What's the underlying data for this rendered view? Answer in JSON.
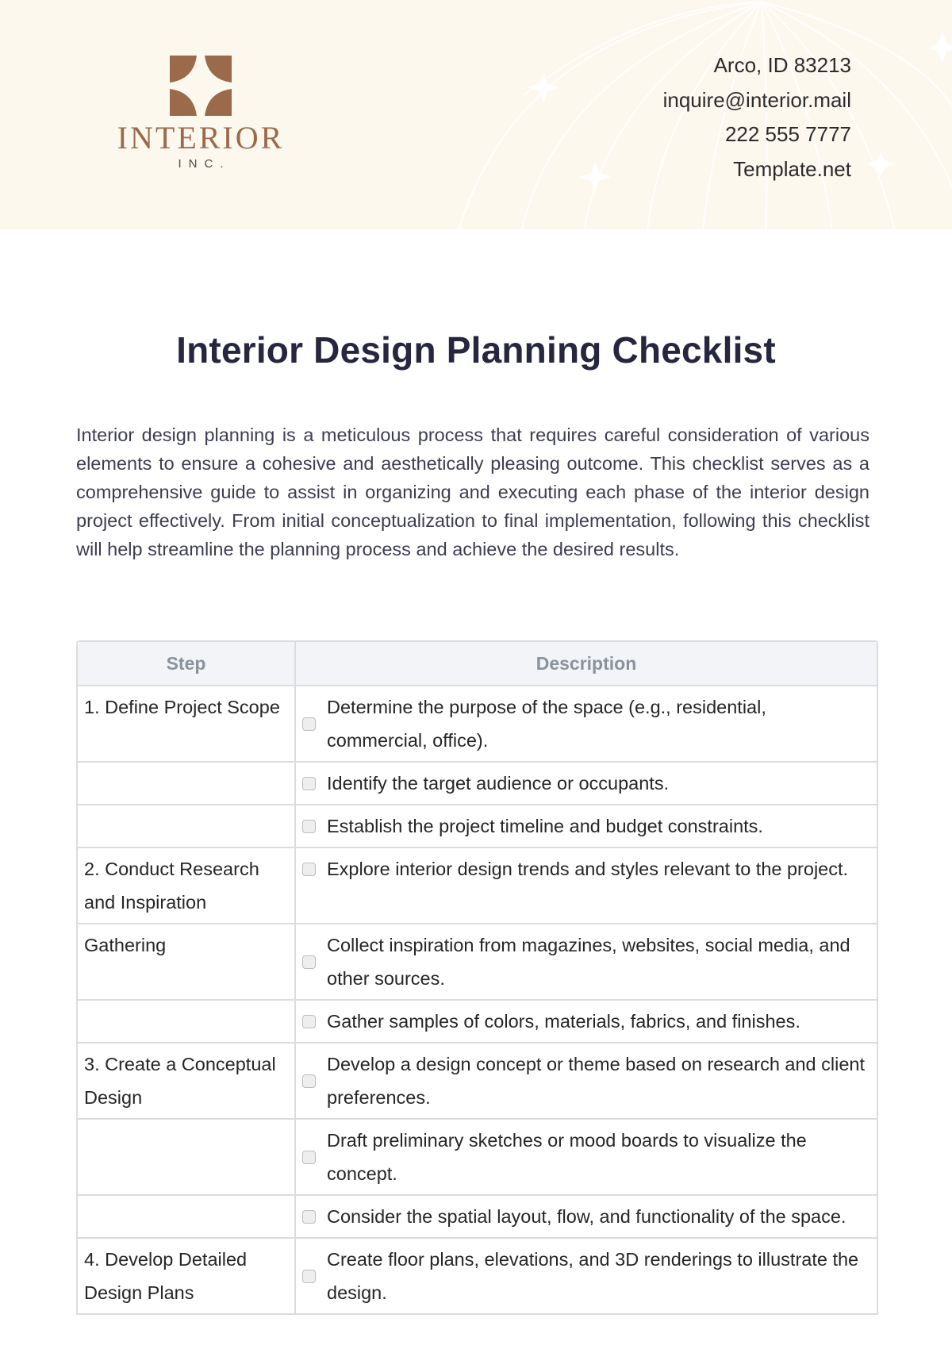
{
  "header": {
    "logo": {
      "name": "INTERIOR",
      "subtitle": "INC.",
      "brand_color": "#9a6a4a"
    },
    "contact": {
      "address": "Arco, ID 83213",
      "email": "inquire@interior.mail",
      "phone": "222 555 7777",
      "website": "Template.net"
    },
    "background_color": "#fdf8ee"
  },
  "document": {
    "title": "Interior Design Planning Checklist",
    "intro": "Interior design planning is a meticulous process that requires careful consideration of various elements to ensure a cohesive and aesthetically pleasing outcome. This checklist serves as a comprehensive guide to assist in organizing and executing each phase of the interior design project effectively. From initial conceptualization to final implementation, following this checklist will help streamline the planning process and achieve the desired results."
  },
  "table": {
    "headers": {
      "step": "Step",
      "description": "Description"
    },
    "rows": [
      {
        "step": "1. Define Project Scope",
        "description": "Determine the purpose of the space (e.g., residential, commercial, office).",
        "checked": false
      },
      {
        "step": "",
        "description": "Identify the target audience or occupants.",
        "checked": false
      },
      {
        "step": "",
        "description": "Establish the project timeline and budget constraints.",
        "checked": false
      },
      {
        "step": "2. Conduct Research and Inspiration",
        "description": "Explore interior design trends and styles relevant to the project.",
        "checked": false
      },
      {
        "step": "Gathering",
        "description": "Collect inspiration from magazines, websites, social media, and other sources.",
        "checked": false
      },
      {
        "step": "",
        "description": "Gather samples of colors, materials, fabrics, and finishes.",
        "checked": false
      },
      {
        "step": "3. Create a Conceptual Design",
        "description": "Develop a design concept or theme based on research and client preferences.",
        "checked": false
      },
      {
        "step": "",
        "description": "Draft preliminary sketches or mood boards to visualize the concept.",
        "checked": false
      },
      {
        "step": "",
        "description": "Consider the spatial layout, flow, and functionality of the space.",
        "checked": false
      },
      {
        "step": "4. Develop Detailed Design Plans",
        "description": "Create floor plans, elevations, and 3D renderings to illustrate the design.",
        "checked": false
      }
    ]
  }
}
